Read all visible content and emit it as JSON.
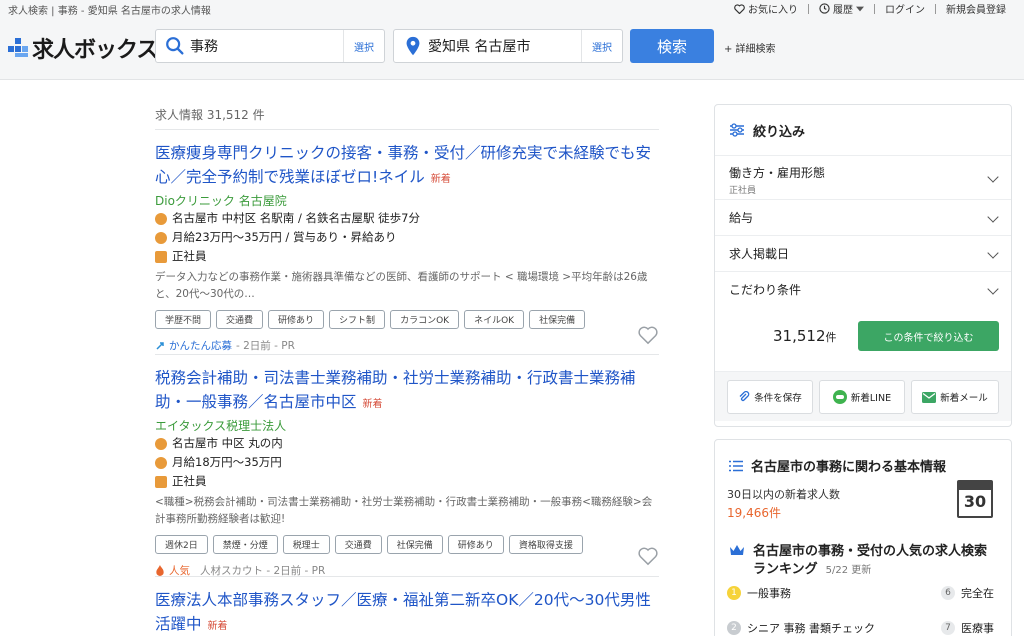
{
  "breadcrumb": "求人検索 | 事務 - 愛知県 名古屋市の求人情報",
  "top_links": {
    "favorites": "お気に入り",
    "history": "履歴",
    "login": "ログイン",
    "register": "新規会員登録"
  },
  "logo_text": "求人ボックス",
  "search": {
    "keyword": "事務",
    "keyword_select": "選択",
    "location": "愛知県 名古屋市",
    "location_select": "選択",
    "button": "検索",
    "advanced": "+ 詳細検索"
  },
  "results": {
    "count_label": "求人情報 31,512 件"
  },
  "jobs": [
    {
      "title": "医療痩身専門クリニックの接客・事務・受付／研修充実で未経験でも安心／完全予約制で残業ほぼゼロ!ネイル",
      "new_badge": "新着",
      "company": "Dioクリニック 名古屋院",
      "location": "名古屋市 中村区 名駅南 / 名鉄名古屋駅 徒歩7分",
      "salary": "月給23万円〜35万円 / 賞与あり・昇給あり",
      "employment": "正社員",
      "description": "データ入力などの事務作業・施術器具準備などの医師、看護師のサポート < 職場環境 >平均年齢は26歳と、20代〜30代の…",
      "tags": [
        "学歴不問",
        "交通費",
        "研修あり",
        "シフト制",
        "カラコンOK",
        "ネイルOK",
        "社保完備"
      ],
      "source": "かんたん応募",
      "meta": "- 2日前 - PR"
    },
    {
      "title": "税務会計補助・司法書士業務補助・社労士業務補助・行政書士業務補助・一般事務／名古屋市中区",
      "new_badge": "新着",
      "company": "エイタックス税理士法人",
      "location": "名古屋市 中区 丸の内",
      "salary": "月給18万円〜35万円",
      "employment": "正社員",
      "description": "<職種>税務会計補助・司法書士業務補助・社労士業務補助・行政書士業務補助・一般事務<職務経験>会計事務所勤務経験者は歓迎!",
      "tags": [
        "週休2日",
        "禁煙・分煙",
        "税理士",
        "交通費",
        "社保完備",
        "研修あり",
        "資格取得支援"
      ],
      "source": "人気",
      "meta": "人材スカウト - 2日前 - PR"
    },
    {
      "title": "医療法人本部事務スタッフ／医療・福祉第二新卒OK／20代〜30代男性活躍中",
      "new_badge": "新着"
    }
  ],
  "filter": {
    "title": "絞り込み",
    "rows": [
      {
        "label": "働き方・雇用形態",
        "sub": "正社員"
      },
      {
        "label": "給与",
        "sub": ""
      },
      {
        "label": "求人掲載日",
        "sub": ""
      },
      {
        "label": "こだわり条件",
        "sub": ""
      }
    ],
    "count": "31,512",
    "count_unit": "件",
    "apply": "この条件で絞り込む",
    "save": "条件を保存",
    "line": "新着LINE",
    "mail": "新着メール"
  },
  "info": {
    "title": "名古屋市の事務に関わる基本情報",
    "new_label": "30日以内の新着求人数",
    "new_value": "19,466件",
    "calendar_day": "30",
    "ranking_title": "名古屋市の事務・受付の人気の求人検索",
    "ranking_title2": "ランキング",
    "ranking_date": "5/22 更新",
    "ranks": [
      {
        "num": "1",
        "label": "一般事務",
        "num2": "6",
        "label2": "完全在"
      },
      {
        "num": "2",
        "label": "シニア 事務 書類チェック",
        "num2": "7",
        "label2": "医療事"
      }
    ]
  },
  "colors": {
    "link": "#1f55c7",
    "company": "#3b9b3b",
    "new": "#d64d3a",
    "search_button": "#3a80e0",
    "apply_button": "#3ca664",
    "accent_orange": "#e8662e"
  }
}
